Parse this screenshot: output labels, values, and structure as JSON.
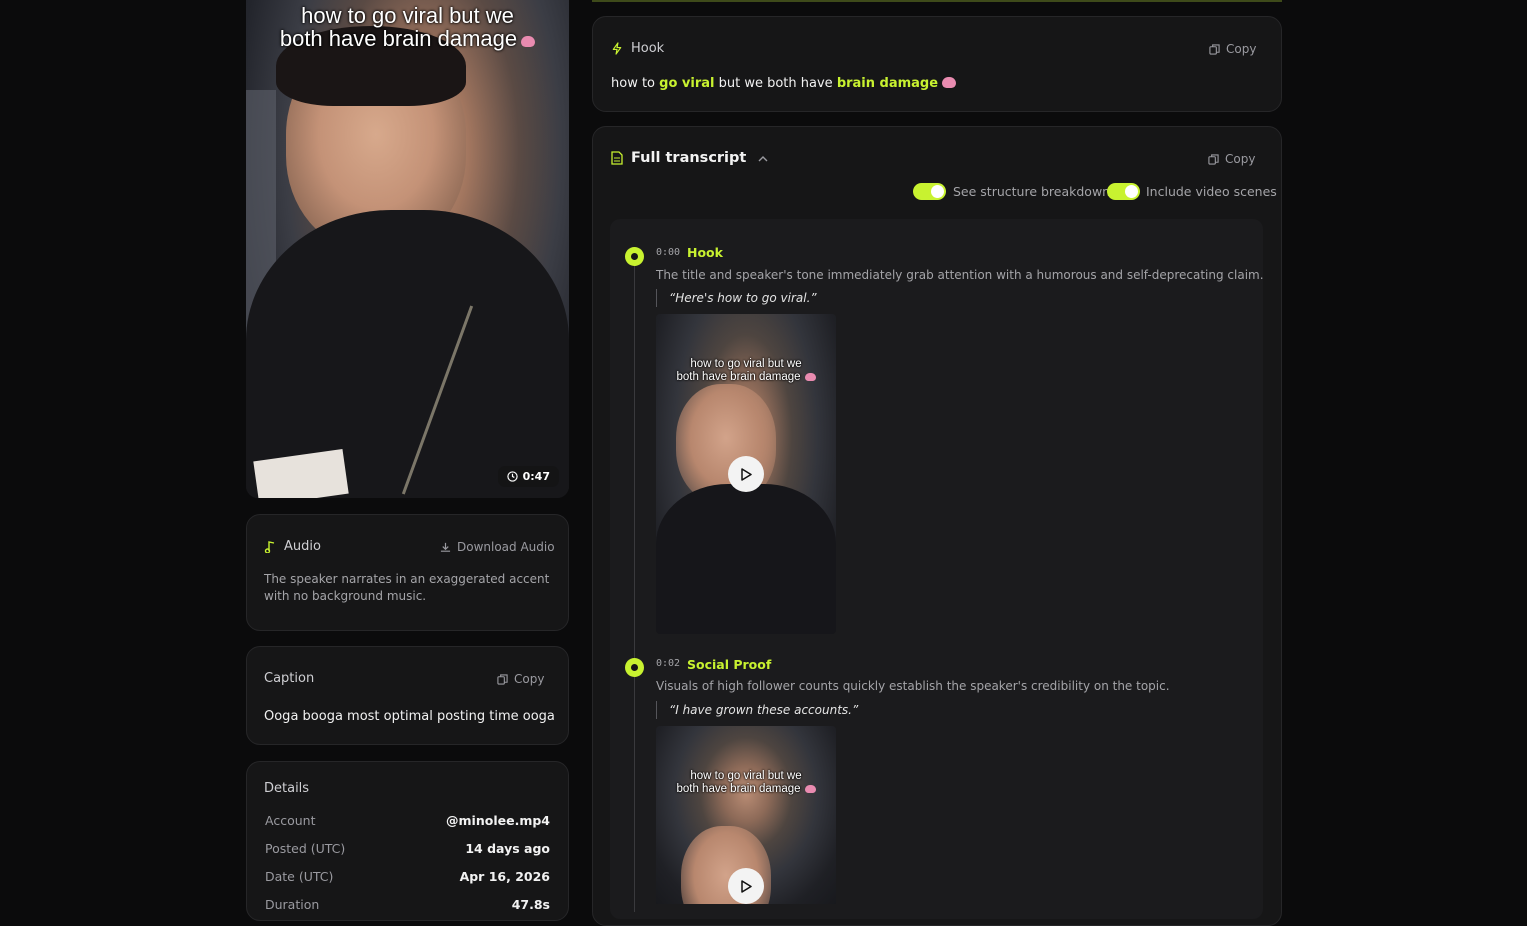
{
  "video": {
    "caption_line1": "how to go viral but we",
    "caption_line2": "both have brain damage",
    "duration": "0:47"
  },
  "audio": {
    "title": "Audio",
    "download_label": "Download Audio",
    "description": "The speaker narrates in an exaggerated accent with no background music."
  },
  "caption": {
    "title": "Caption",
    "copy_label": "Copy",
    "text": "Ooga booga most optimal posting time ooga"
  },
  "details": {
    "title": "Details",
    "rows": [
      {
        "key": "Account",
        "value": "@minolee.mp4"
      },
      {
        "key": "Posted (UTC)",
        "value": "14 days ago"
      },
      {
        "key": "Date (UTC)",
        "value": "Apr 16, 2026"
      },
      {
        "key": "Duration",
        "value": "47.8s"
      }
    ]
  },
  "hook": {
    "title": "Hook",
    "copy_label": "Copy",
    "parts": [
      "how to ",
      "go viral",
      " but we both have ",
      "brain damage"
    ]
  },
  "transcript": {
    "title": "Full transcript",
    "copy_label": "Copy",
    "toggle_structure": "See structure breakdown",
    "toggle_scenes": "Include video scenes",
    "sections": [
      {
        "time": "0:00",
        "title": "Hook",
        "description": "The title and speaker's tone immediately grab attention with a humorous and self-deprecating claim.",
        "quote": "“Here's how to go viral.”",
        "scene_caption_1": "how to go viral but we",
        "scene_caption_2": "both have brain damage"
      },
      {
        "time": "0:02",
        "title": "Social Proof",
        "description": "Visuals of high follower counts quickly establish the speaker's credibility on the topic.",
        "quote": "“I have grown these accounts.”",
        "scene_caption_1": "how to go viral but we",
        "scene_caption_2": "both have brain damage"
      }
    ]
  },
  "colors": {
    "accent": "#c8f230",
    "background": "#0b0b0c",
    "card": "#161617"
  }
}
